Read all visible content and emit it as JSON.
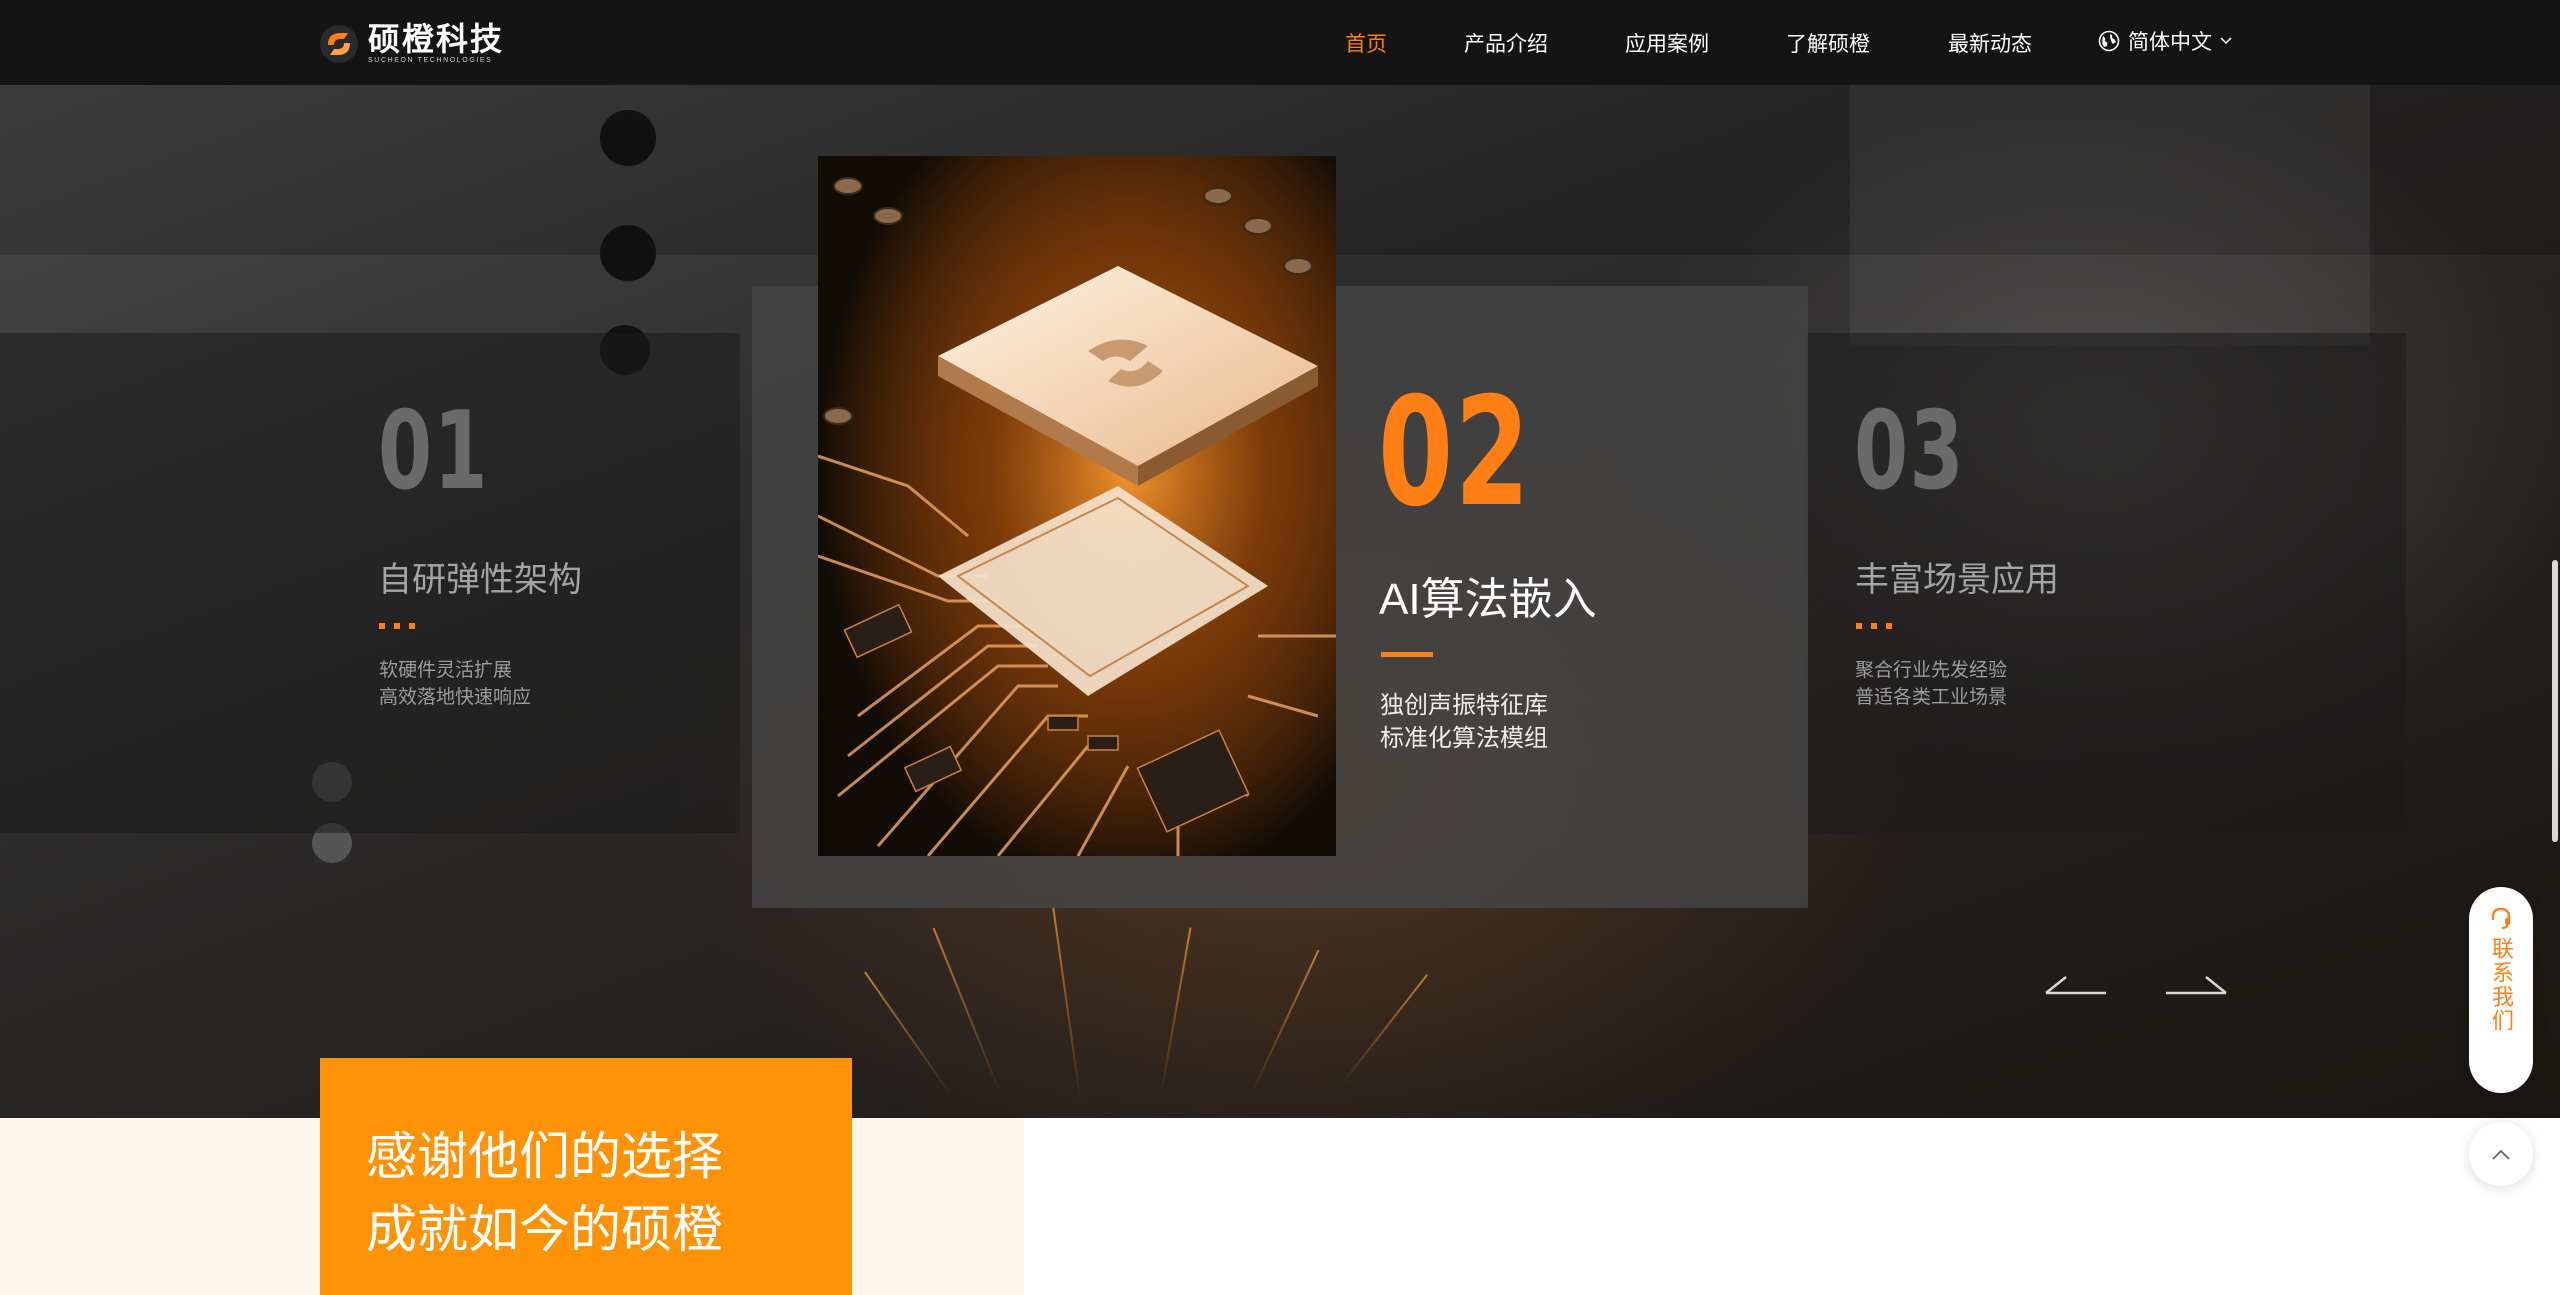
{
  "header": {
    "logo": {
      "cn": "硕橙科技",
      "en": "SUCHEON TECHNOLOGIES"
    },
    "nav": [
      {
        "label": "首页",
        "active": true
      },
      {
        "label": "产品介绍",
        "active": false
      },
      {
        "label": "应用案例",
        "active": false
      },
      {
        "label": "了解硕橙",
        "active": false
      },
      {
        "label": "最新动态",
        "active": false
      }
    ],
    "language": "简体中文",
    "icons": {
      "language": "globe-icon",
      "dropdown": "chevron-down-icon"
    }
  },
  "slider": {
    "slides": [
      {
        "num": "01",
        "title": "自研弹性架构",
        "desc": [
          "软硬件灵活扩展",
          "高效落地快速响应"
        ]
      },
      {
        "num": "02",
        "title": "AI算法嵌入",
        "desc": [
          "独创声振特征库",
          "标准化算法模组"
        ]
      },
      {
        "num": "03",
        "title": "丰富场景应用",
        "desc": [
          "聚合行业先发经验",
          "普适各类工业场景"
        ]
      }
    ],
    "active_index": 1,
    "icons": {
      "prev": "arrow-left-icon",
      "next": "arrow-right-icon"
    }
  },
  "clients": {
    "headline": [
      "感谢他们的选择",
      "成就如今的硕橙"
    ]
  },
  "floating": {
    "contact_label": "联系我们",
    "icons": {
      "contact": "headset-icon",
      "back_to_top": "chevron-up-icon"
    }
  },
  "colors": {
    "accent": "#ff7f14",
    "header_bg": "#141414",
    "orange_block": "#ff9308"
  }
}
